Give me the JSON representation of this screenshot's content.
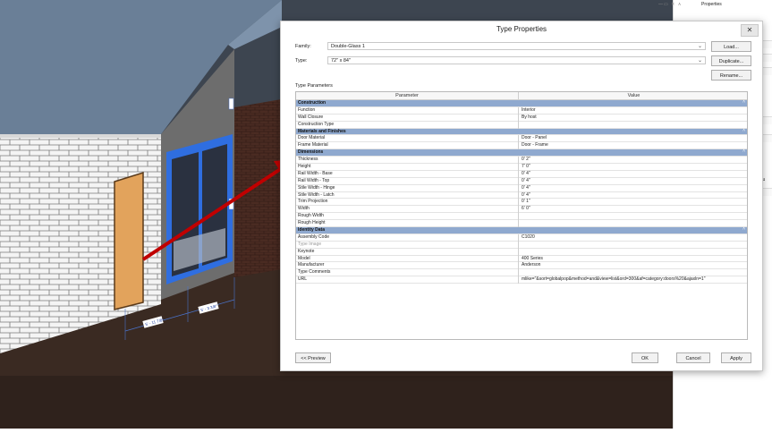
{
  "properties_palette": {
    "title": "Properties",
    "window_controls": "—▭ ✕ ∧",
    "side_text": "ifu"
  },
  "viewport": {
    "dimension_labels": [
      "5' - 11 7/8\"",
      "5' - 3 3/8\""
    ],
    "accent_arrow_color": "#c00000"
  },
  "dialog": {
    "title": "Type Properties",
    "close_label": "✕",
    "family_label": "Family:",
    "family_value": "Double-Glass 1",
    "type_label": "Type:",
    "type_value": "72\" x 84\"",
    "buttons": {
      "load": "Load...",
      "duplicate": "Duplicate...",
      "rename": "Rename..."
    },
    "type_parameters_label": "Type Parameters",
    "columns": {
      "parameter": "Parameter",
      "value": "Value"
    },
    "rows": [
      {
        "group": true,
        "param": "Construction",
        "value": ""
      },
      {
        "group": false,
        "param": "Function",
        "value": "Interior"
      },
      {
        "group": false,
        "param": "Wall Closure",
        "value": "By host"
      },
      {
        "group": false,
        "param": "Construction Type",
        "value": ""
      },
      {
        "group": true,
        "param": "Materials and Finishes",
        "value": ""
      },
      {
        "group": false,
        "param": "Door Material",
        "value": "Door - Panel"
      },
      {
        "group": false,
        "param": "Frame Material",
        "value": "Door - Frame"
      },
      {
        "group": true,
        "param": "Dimensions",
        "value": ""
      },
      {
        "group": false,
        "param": "Thickness",
        "value": "0'  2\""
      },
      {
        "group": false,
        "param": "Height",
        "value": "7'  0\""
      },
      {
        "group": false,
        "param": "Rail Width - Base",
        "value": "0'  4\""
      },
      {
        "group": false,
        "param": "Rail Width - Top",
        "value": "0'  4\""
      },
      {
        "group": false,
        "param": "Stile Width - Hinge",
        "value": "0'  4\""
      },
      {
        "group": false,
        "param": "Stile Width - Latch",
        "value": "0'  4\""
      },
      {
        "group": false,
        "param": "Trim Projection",
        "value": "0'  1\""
      },
      {
        "group": false,
        "param": "Width",
        "value": "6'  0\""
      },
      {
        "group": false,
        "param": "Rough Width",
        "value": ""
      },
      {
        "group": false,
        "param": "Rough Height",
        "value": ""
      },
      {
        "group": true,
        "param": "Identity Data",
        "value": ""
      },
      {
        "group": false,
        "param": "Assembly Code",
        "value": "C1020"
      },
      {
        "group": false,
        "param": "Type Image",
        "value": "",
        "muted": true
      },
      {
        "group": false,
        "param": "Keynote",
        "value": ""
      },
      {
        "group": false,
        "param": "Model",
        "value": "400 Series"
      },
      {
        "group": false,
        "param": "Manufacturer",
        "value": "Anderson"
      },
      {
        "group": false,
        "param": "Type Comments",
        "value": ""
      },
      {
        "group": false,
        "param": "URL",
        "value": "mlike=\"&sort=globalpop&method=and&view=list&ord=300&af=category:doors%20&ajaxln=1\""
      }
    ],
    "footer": {
      "preview": "<< Preview",
      "ok": "OK",
      "cancel": "Cancel",
      "apply": "Apply"
    }
  }
}
